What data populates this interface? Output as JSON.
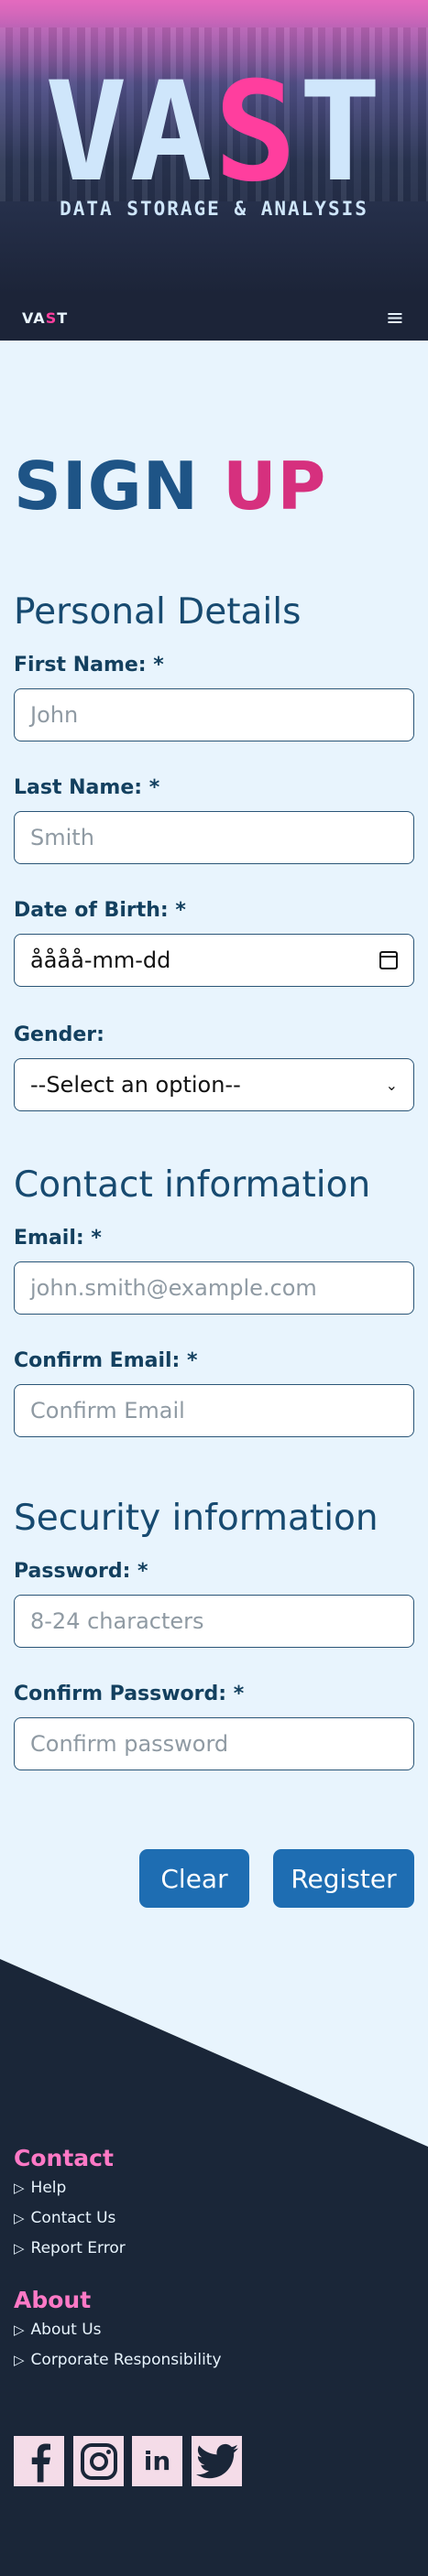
{
  "header": {
    "title_part1": "VA",
    "title_accent": "S",
    "title_part2": "T",
    "subtitle": "DATA STORAGE & ANALYSIS",
    "nav_logo_part1": "VA",
    "nav_logo_accent": "S",
    "nav_logo_part2": "T",
    "menu_icon": "≡"
  },
  "form": {
    "title_main": "SIGN ",
    "title_accent": "UP",
    "sections": {
      "personal": "Personal Details",
      "contact": "Contact information",
      "security": "Security information"
    },
    "fields": {
      "first_name": {
        "label": "First Name: *",
        "placeholder": "John"
      },
      "last_name": {
        "label": "Last Name: *",
        "placeholder": "Smith"
      },
      "dob": {
        "label": "Date of Birth: *",
        "value": "åååå-mm-dd"
      },
      "gender": {
        "label": "Gender:",
        "selected": "--Select an option--"
      },
      "email": {
        "label": "Email: *",
        "placeholder": "john.smith@example.com"
      },
      "confirm_email": {
        "label": "Confirm Email: *",
        "placeholder": "Confirm Email"
      },
      "password": {
        "label": "Password: *",
        "placeholder": "8-24 characters"
      },
      "confirm_password": {
        "label": "Confirm Password: *",
        "placeholder": "Confirm password"
      }
    },
    "buttons": {
      "clear": "Clear",
      "register": "Register"
    }
  },
  "footer": {
    "contact": {
      "heading": "Contact",
      "links": [
        "Help",
        "Contact Us",
        "Report Error"
      ]
    },
    "about": {
      "heading": "About",
      "links": [
        "About Us",
        "Corporate Responsibility"
      ]
    },
    "social_icons": [
      "facebook-icon",
      "instagram-icon",
      "linkedin-icon",
      "twitter-icon"
    ],
    "linkedin_text": "in"
  },
  "colors": {
    "accent_pink": "#ff3e9e",
    "primary_blue": "#1e6db2",
    "dark_navy": "#1c2438",
    "page_bg": "#e8f4fd"
  }
}
